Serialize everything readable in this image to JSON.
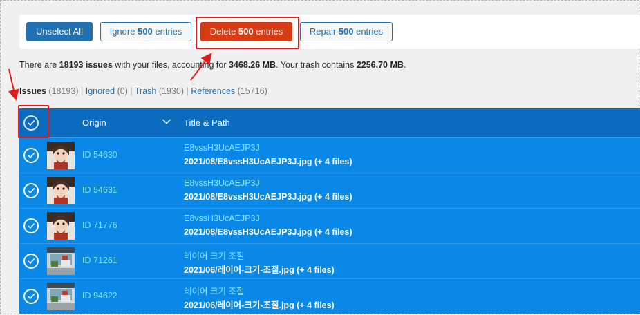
{
  "toolbar": {
    "unselect_label": "Unselect All",
    "ignore_prefix": "Ignore ",
    "ignore_count": "500",
    "ignore_suffix": " entries",
    "delete_prefix": "Delete ",
    "delete_count": "500",
    "delete_suffix": " entries",
    "repair_prefix": "Repair ",
    "repair_count": "500",
    "repair_suffix": " entries"
  },
  "summary": {
    "p1": "There are ",
    "issues_count": "18193 issues",
    "p2": " with your files, accounting for ",
    "size": "3468.26 MB",
    "p3": ". Your trash contains ",
    "trash_size": "2256.70 MB",
    "p4": "."
  },
  "filters": {
    "issues_label": "Issues",
    "issues_count": "(18193)",
    "ignored_label": "Ignored",
    "ignored_count": "(0)",
    "trash_label": "Trash",
    "trash_count": "(1930)",
    "references_label": "References",
    "references_count": "(15716)",
    "separator": "|"
  },
  "table": {
    "col_origin": "Origin",
    "col_title": "Title & Path",
    "rows": [
      {
        "id": "ID 54630",
        "title": "E8vssH3UcAEJP3J",
        "path": "2021/08/E8vssH3UcAEJP3J.jpg (+ 4 files)",
        "thumb": "portrait"
      },
      {
        "id": "ID 54631",
        "title": "E8vssH3UcAEJP3J",
        "path": "2021/08/E8vssH3UcAEJP3J.jpg (+ 4 files)",
        "thumb": "portrait"
      },
      {
        "id": "ID 71776",
        "title": "E8vssH3UcAEJP3J",
        "path": "2021/08/E8vssH3UcAEJP3J.jpg (+ 4 files)",
        "thumb": "portrait"
      },
      {
        "id": "ID 71261",
        "title": "레이어 크기 조절",
        "path": "2021/06/레이어-크기-조절.jpg (+ 4 files)",
        "thumb": "landscape"
      },
      {
        "id": "ID 94622",
        "title": "레이어 크기 조절",
        "path": "2021/06/레이어-크기-조절.jpg (+ 4 files)",
        "thumb": "landscape"
      }
    ]
  },
  "colors": {
    "accent": "#2271b1",
    "danger": "#d63d14",
    "row_selected": "#0a88e8",
    "header": "#0b6cbf",
    "annotation": "#e0191a"
  },
  "icons": {
    "check": "check-icon",
    "chevron": "chevron-down-icon"
  }
}
